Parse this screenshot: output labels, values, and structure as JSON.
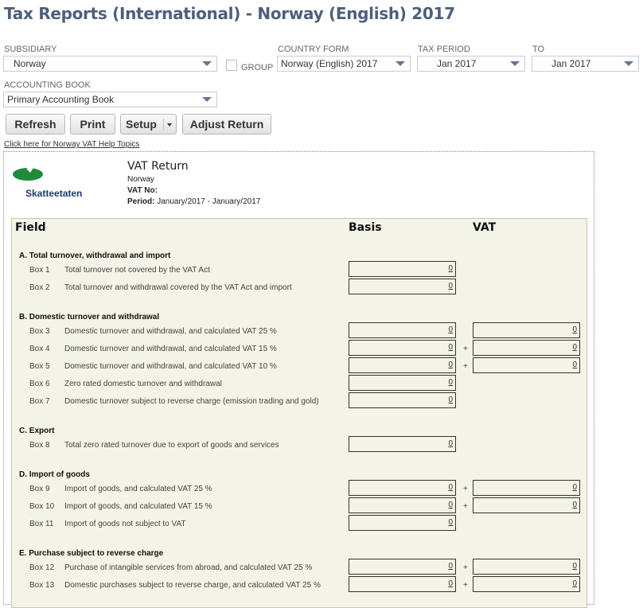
{
  "page": {
    "title": "Tax Reports (International) - Norway (English) 2017"
  },
  "filters": {
    "subsidiary": {
      "label": "SUBSIDIARY",
      "value": "Norway"
    },
    "group_label": "GROUP",
    "country_form": {
      "label": "COUNTRY FORM",
      "value": "Norway (English) 2017"
    },
    "tax_period": {
      "label": "TAX PERIOD",
      "value": "Jan 2017"
    },
    "to": {
      "label": "TO",
      "value": "Jan 2017"
    },
    "accounting_book": {
      "label": "ACCOUNTING BOOK",
      "value": "Primary Accounting Book"
    }
  },
  "toolbar": {
    "refresh": "Refresh",
    "print": "Print",
    "setup": "Setup",
    "adjust": "Adjust Return"
  },
  "help_link": "Click here for Norway VAT Help Topics",
  "report": {
    "logo_text": "Skatteetaten",
    "title": "VAT Return",
    "country": "Norway",
    "vat_no_label": "VAT No:",
    "period_label": "Period:",
    "period_value": "January/2017 - January/2017",
    "columns": {
      "field": "Field",
      "basis": "Basis",
      "vat": "VAT"
    },
    "sections": {
      "a": "A. Total turnover, withdrawal and import",
      "b": "B. Domestic turnover and withdrawal",
      "c": "C. Export",
      "d": "D. Import of goods",
      "e": "E. Purchase subject to reverse charge"
    },
    "rows": [
      {
        "box": "Box 1",
        "desc": "Total turnover not covered by the VAT Act",
        "basis": "0"
      },
      {
        "box": "Box 2",
        "desc": "Total turnover and withdrawal covered by the VAT Act and import",
        "basis": "0"
      },
      {
        "box": "Box 3",
        "desc": "Domestic turnover and withdrawal, and calculated VAT 25 %",
        "basis": "0",
        "vat": "0"
      },
      {
        "box": "Box 4",
        "desc": "Domestic turnover and withdrawal, and calculated VAT 15 %",
        "basis": "0",
        "op": "+",
        "vat": "0"
      },
      {
        "box": "Box 5",
        "desc": "Domestic turnover and withdrawal, and calculated VAT 10 %",
        "basis": "0",
        "op": "+",
        "vat": "0"
      },
      {
        "box": "Box 6",
        "desc": "Zero rated domestic turnover and withdrawal",
        "basis": "0"
      },
      {
        "box": "Box 7",
        "desc": "Domestic turnover subject to reverse charge (emission trading and gold)",
        "basis": "0"
      },
      {
        "box": "Box 8",
        "desc": "Total zero rated turnover due to export of goods and services",
        "basis": "0"
      },
      {
        "box": "Box 9",
        "desc": "Import of goods, and calculated VAT 25 %",
        "basis": "0",
        "op": "+",
        "vat": "0"
      },
      {
        "box": "Box 10",
        "desc": "Import of goods, and calculated VAT 15 %",
        "basis": "0",
        "op": "+",
        "vat": "0"
      },
      {
        "box": "Box 11",
        "desc": "Import of goods not subject to VAT",
        "basis": "0"
      },
      {
        "box": "Box 12",
        "desc": "Purchase of intangible services from abroad, and calculated VAT 25 %",
        "basis": "0",
        "op": "+",
        "vat": "0"
      },
      {
        "box": "Box 13",
        "desc": "Domestic purchases subject to reverse charge, and calculated VAT 25 %",
        "basis": "0",
        "op": "+",
        "vat": "0"
      }
    ]
  },
  "colors": {
    "title": "#4d5f79",
    "arrow": "#607799",
    "panel": "#f3f3e7",
    "logo_green": "#1e8a3a",
    "logo_blue": "#1e3a6e"
  }
}
